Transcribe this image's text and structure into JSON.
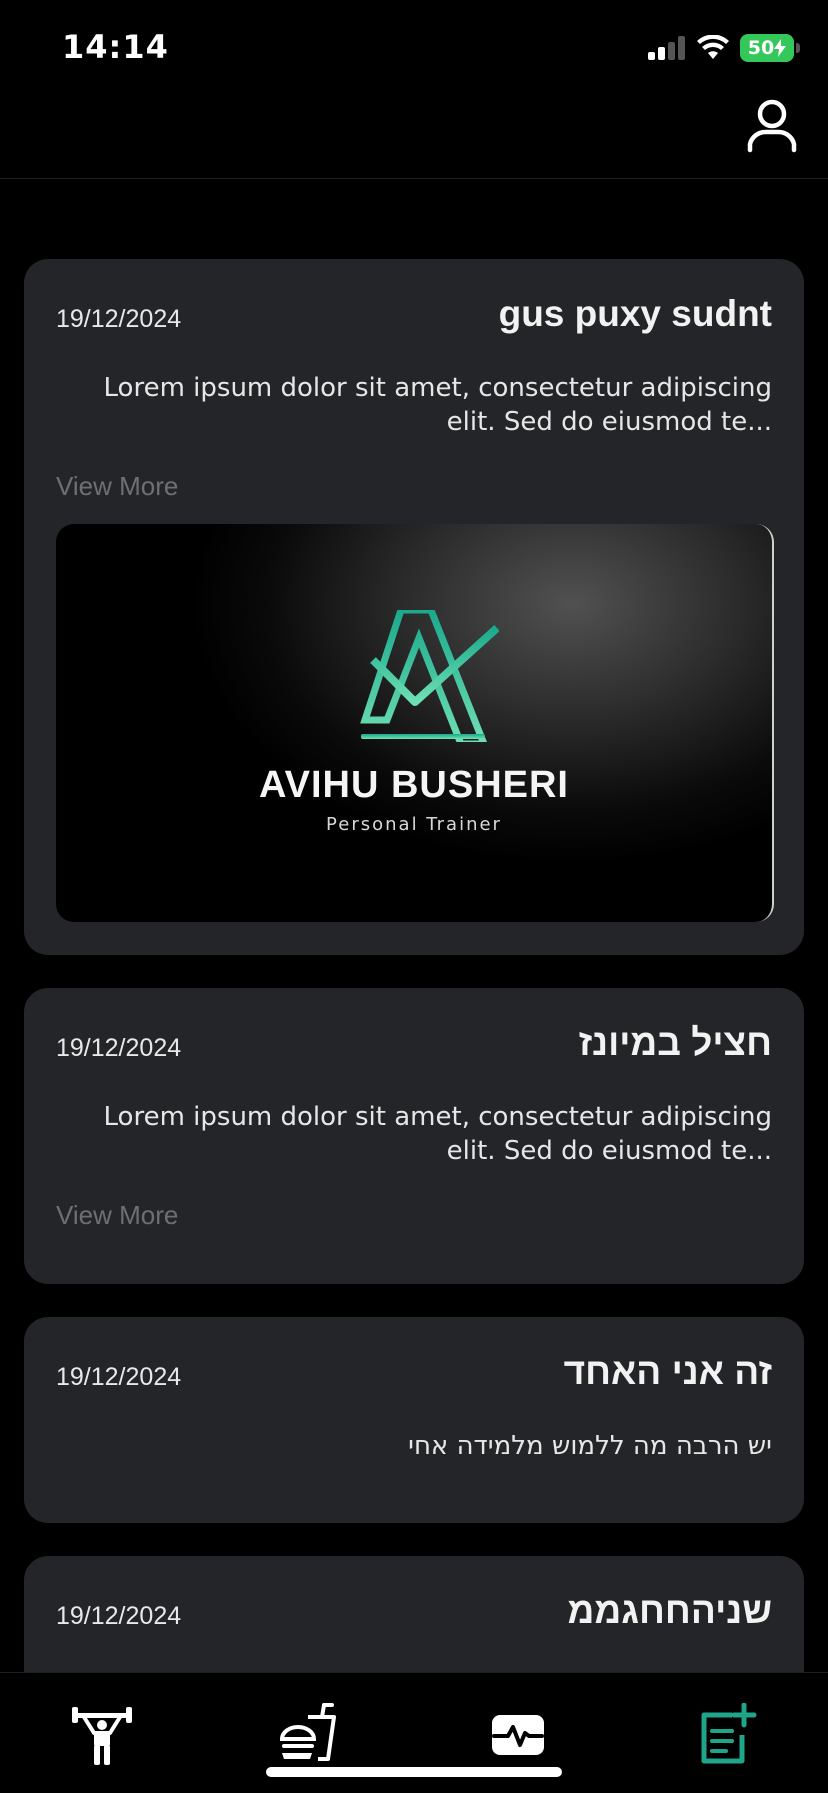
{
  "status_bar": {
    "time": "14:14",
    "battery": "50"
  },
  "posts": [
    {
      "title": "gus puxy sudnt",
      "date": "19/12/2024",
      "description": "Lorem ipsum dolor sit amet, consectetur adipiscing elit. Sed do eiusmod te...",
      "view_more": "View More",
      "image": {
        "brand_name": "AVIHU BUSHERI",
        "brand_subtitle": "Personal Trainer"
      }
    },
    {
      "title": "חציל במיונז",
      "date": "19/12/2024",
      "description": "Lorem ipsum dolor sit amet, consectetur adipiscing elit. Sed do eiusmod te...",
      "view_more": "View More"
    },
    {
      "title": "זה אני האחד",
      "date": "19/12/2024",
      "description": "יש הרבה מה ללמוש מלמידה אחי"
    },
    {
      "title": "שניהחחגממ",
      "date": "19/12/2024"
    }
  ],
  "bottom_nav": {
    "tabs": [
      {
        "icon": "weightlifter-icon",
        "active": false
      },
      {
        "icon": "meal-icon",
        "active": false
      },
      {
        "icon": "activity-monitor-icon",
        "active": false
      },
      {
        "icon": "add-post-icon",
        "active": true
      }
    ],
    "active_color": "#1fa58a",
    "inactive_color": "#ffffff"
  }
}
